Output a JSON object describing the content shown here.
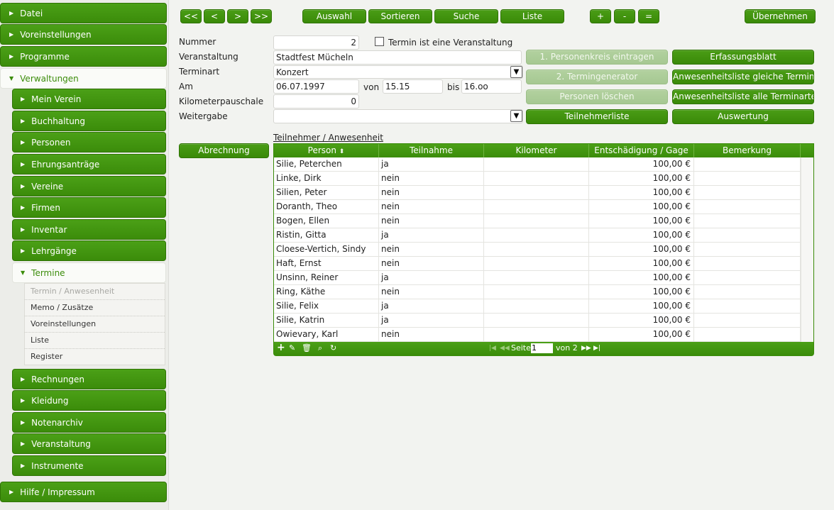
{
  "sidebar": {
    "top": [
      "Datei",
      "Voreinstellungen",
      "Programme"
    ],
    "verwaltungen": "Verwaltungen",
    "sub_before": [
      "Mein Verein",
      "Buchhaltung",
      "Personen",
      "Ehrungsanträge",
      "Vereine",
      "Firmen",
      "Inventar",
      "Lehrgänge"
    ],
    "termine": "Termine",
    "termine_items": [
      "Termin / Anwesenheit",
      "Memo / Zusätze",
      "Voreinstellungen",
      "Liste",
      "Register"
    ],
    "sub_after": [
      "Rechnungen",
      "Kleidung",
      "Notenarchiv",
      "Veranstaltung",
      "Instrumente"
    ],
    "bottom": "Hilfe / Impressum"
  },
  "toolbar": {
    "first": "<<",
    "prev": "<",
    "next": ">",
    "last": ">>",
    "auswahl": "Auswahl",
    "sortieren": "Sortieren",
    "suche": "Suche",
    "liste": "Liste",
    "plus": "+",
    "minus": "-",
    "equals": "=",
    "uebernehmen": "Übernehmen"
  },
  "form": {
    "nummer_label": "Nummer",
    "nummer": "2",
    "termin_veranstaltung_label": "Termin ist eine Veranstaltung",
    "veranstaltung_label": "Veranstaltung",
    "veranstaltung": "Stadtfest Mücheln",
    "terminart_label": "Terminart",
    "terminart": "Konzert",
    "am_label": "Am",
    "am": "06.07.1997",
    "von_label": "von",
    "von": "15.15",
    "bis_label": "bis",
    "bis": "16.oo",
    "km_label": "Kilometerpauschale",
    "km": "0",
    "weitergabe_label": "Weitergabe",
    "weitergabe": ""
  },
  "actions": {
    "personenkreis": "1. Personenkreis eintragen",
    "termingenerator": "2. Termingenerator",
    "personen_loeschen": "Personen löschen",
    "teilnehmerliste": "Teilnehmerliste",
    "erfassungsblatt": "Erfassungsblatt",
    "anw_gleich": "Anwesenheitsliste gleiche Terminart",
    "anw_alle": "Anwesenheitsliste alle Terminarten",
    "auswertung": "Auswertung",
    "abrechnung": "Abrechnung"
  },
  "grid": {
    "title": "Teilnehmer / Anwesenheit",
    "columns": [
      "Person",
      "Teilnahme",
      "Kilometer",
      "Entschädigung / Gage",
      "Bemerkung"
    ],
    "sort_icon": "sort-icon",
    "rows": [
      [
        "Silie, Peterchen",
        "ja",
        "",
        "100,00 €",
        ""
      ],
      [
        "Linke, Dirk",
        "nein",
        "",
        "100,00 €",
        ""
      ],
      [
        "Silien, Peter",
        "nein",
        "",
        "100,00 €",
        ""
      ],
      [
        "Doranth, Theo",
        "nein",
        "",
        "100,00 €",
        ""
      ],
      [
        "Bogen, Ellen",
        "nein",
        "",
        "100,00 €",
        ""
      ],
      [
        "Ristin, Gitta",
        "ja",
        "",
        "100,00 €",
        ""
      ],
      [
        "Cloese-Vertich, Sindy",
        "nein",
        "",
        "100,00 €",
        ""
      ],
      [
        "Haft, Ernst",
        "nein",
        "",
        "100,00 €",
        ""
      ],
      [
        "Unsinn, Reiner",
        "ja",
        "",
        "100,00 €",
        ""
      ],
      [
        "Ring, Käthe",
        "nein",
        "",
        "100,00 €",
        ""
      ],
      [
        "Silie, Felix",
        "ja",
        "",
        "100,00 €",
        ""
      ],
      [
        "Silie, Katrin",
        "ja",
        "",
        "100,00 €",
        ""
      ],
      [
        "Owievary, Karl",
        "nein",
        "",
        "100,00 €",
        ""
      ]
    ],
    "pager": {
      "seite_label": "Seite",
      "page": "1",
      "von_label": "von 2"
    }
  },
  "colors": {
    "accent": "#3b8c0a",
    "accent_light": "#4ba017",
    "disabled": "#a6c892"
  }
}
